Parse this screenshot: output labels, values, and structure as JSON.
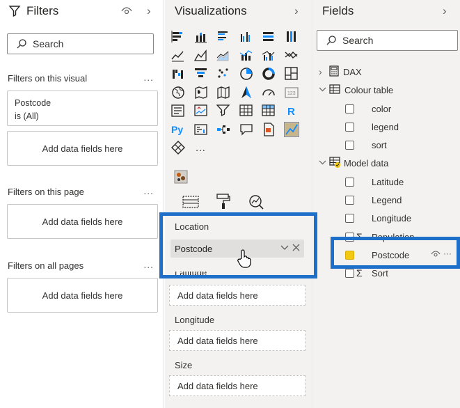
{
  "filters": {
    "title": "Filters",
    "search_placeholder": "Search",
    "visual_section": "Filters on this visual",
    "postcode_card": {
      "field": "Postcode",
      "state": "is (All)"
    },
    "add_label": "Add data fields here",
    "page_section": "Filters on this page",
    "all_pages_section": "Filters on all pages",
    "more": "..."
  },
  "viz": {
    "title": "Visualizations",
    "more_visuals": "...",
    "icons": [
      "stacked-bar-icon",
      "stacked-column-icon",
      "clustered-bar-icon",
      "clustered-column-icon",
      "100-bar-icon",
      "100-column-icon",
      "line-chart-icon",
      "area-chart-icon",
      "stacked-area-icon",
      "line-column-icon",
      "line-clustered-icon",
      "ribbon-chart-icon",
      "waterfall-icon",
      "funnel-icon",
      "scatter-icon",
      "pie-icon",
      "donut-icon",
      "treemap-icon",
      "map-icon",
      "filled-map-icon",
      "shape-map-icon",
      "azure-map-icon",
      "gauge-icon",
      "card-icon",
      "multirow-card-icon",
      "kpi-icon",
      "slicer-icon",
      "table-icon",
      "matrix-icon",
      "r-visual-icon",
      "python-icon",
      "key-influencers-icon",
      "decomposition-tree-icon",
      "qa-icon",
      "paginated-report-icon",
      "arcgis-icon",
      "power-apps-icon"
    ],
    "r_text": "R",
    "py_text": "Py",
    "location_label": "Location",
    "postcode_field": "Postcode",
    "latitude_label": "Latitude",
    "add_label": "Add data fields here",
    "longitude_label": "Longitude",
    "size_label": "Size",
    "highlight_color": "#1d6fc9"
  },
  "fields": {
    "title": "Fields",
    "search_placeholder": "Search",
    "tables": [
      {
        "name": "DAX",
        "expanded": false
      },
      {
        "name": "Colour table",
        "expanded": true,
        "items": [
          "color",
          "legend",
          "sort"
        ]
      },
      {
        "name": "Model data",
        "expanded": true,
        "items": [
          "Latitude",
          "Legend",
          "Longitude",
          "Population",
          "Postcode",
          "Sort"
        ]
      }
    ],
    "checked_field": "Postcode",
    "checked_color": "#f2c811"
  }
}
